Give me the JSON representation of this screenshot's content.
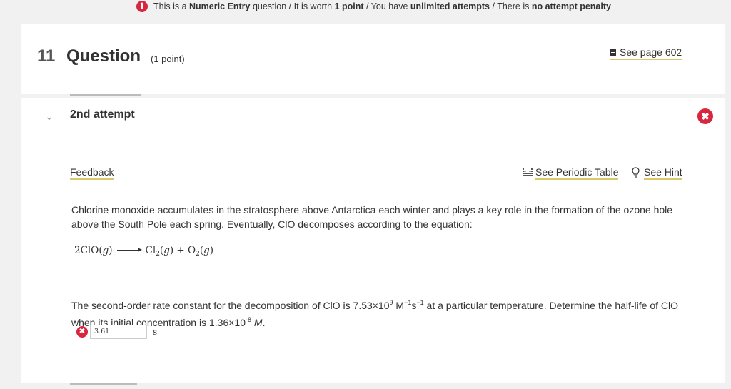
{
  "banner": {
    "icon": "info-icon",
    "text_parts": [
      "This is a ",
      "Numeric Entry",
      " question / It is worth ",
      "1 point",
      " / You have ",
      "unlimited attempts",
      " / There is ",
      "no attempt penalty"
    ]
  },
  "question": {
    "number": "11",
    "title": "Question",
    "points": "(1 point)",
    "see_page": "See page 602"
  },
  "attempt": {
    "label": "2nd attempt",
    "feedback_link": "Feedback",
    "periodic_link": "See Periodic Table",
    "hint_link": "See Hint",
    "paragraph1": "Chlorine monoxide accumulates in the stratosphere above Antarctica each winter and plays a key role in the formation of the ozone hole above the South Pole each spring. Eventually, ClO decomposes according to the equation:",
    "equation": {
      "reactant_coef": "2",
      "reactant": "ClO",
      "state": "g",
      "product1": "Cl",
      "product1_sub": "2",
      "plus": "+",
      "product2": "O",
      "product2_sub": "2"
    },
    "paragraph2": {
      "t1": "The second-order rate constant for the decomposition of ClO is 7.53×10",
      "exp1": "9",
      "t2": " M",
      "exp2": "−1",
      "t3": "s",
      "exp3": "−1",
      "t4": " at a particular temperature. Determine the half-life of ClO when its initial concentration is 1.36×10",
      "exp4": "-8",
      "t5": " M",
      "t6": "."
    },
    "answer_value": "3.61",
    "answer_unit": "s"
  },
  "colors": {
    "error_red": "#d7263d",
    "link_underline": "#d9c76a"
  }
}
